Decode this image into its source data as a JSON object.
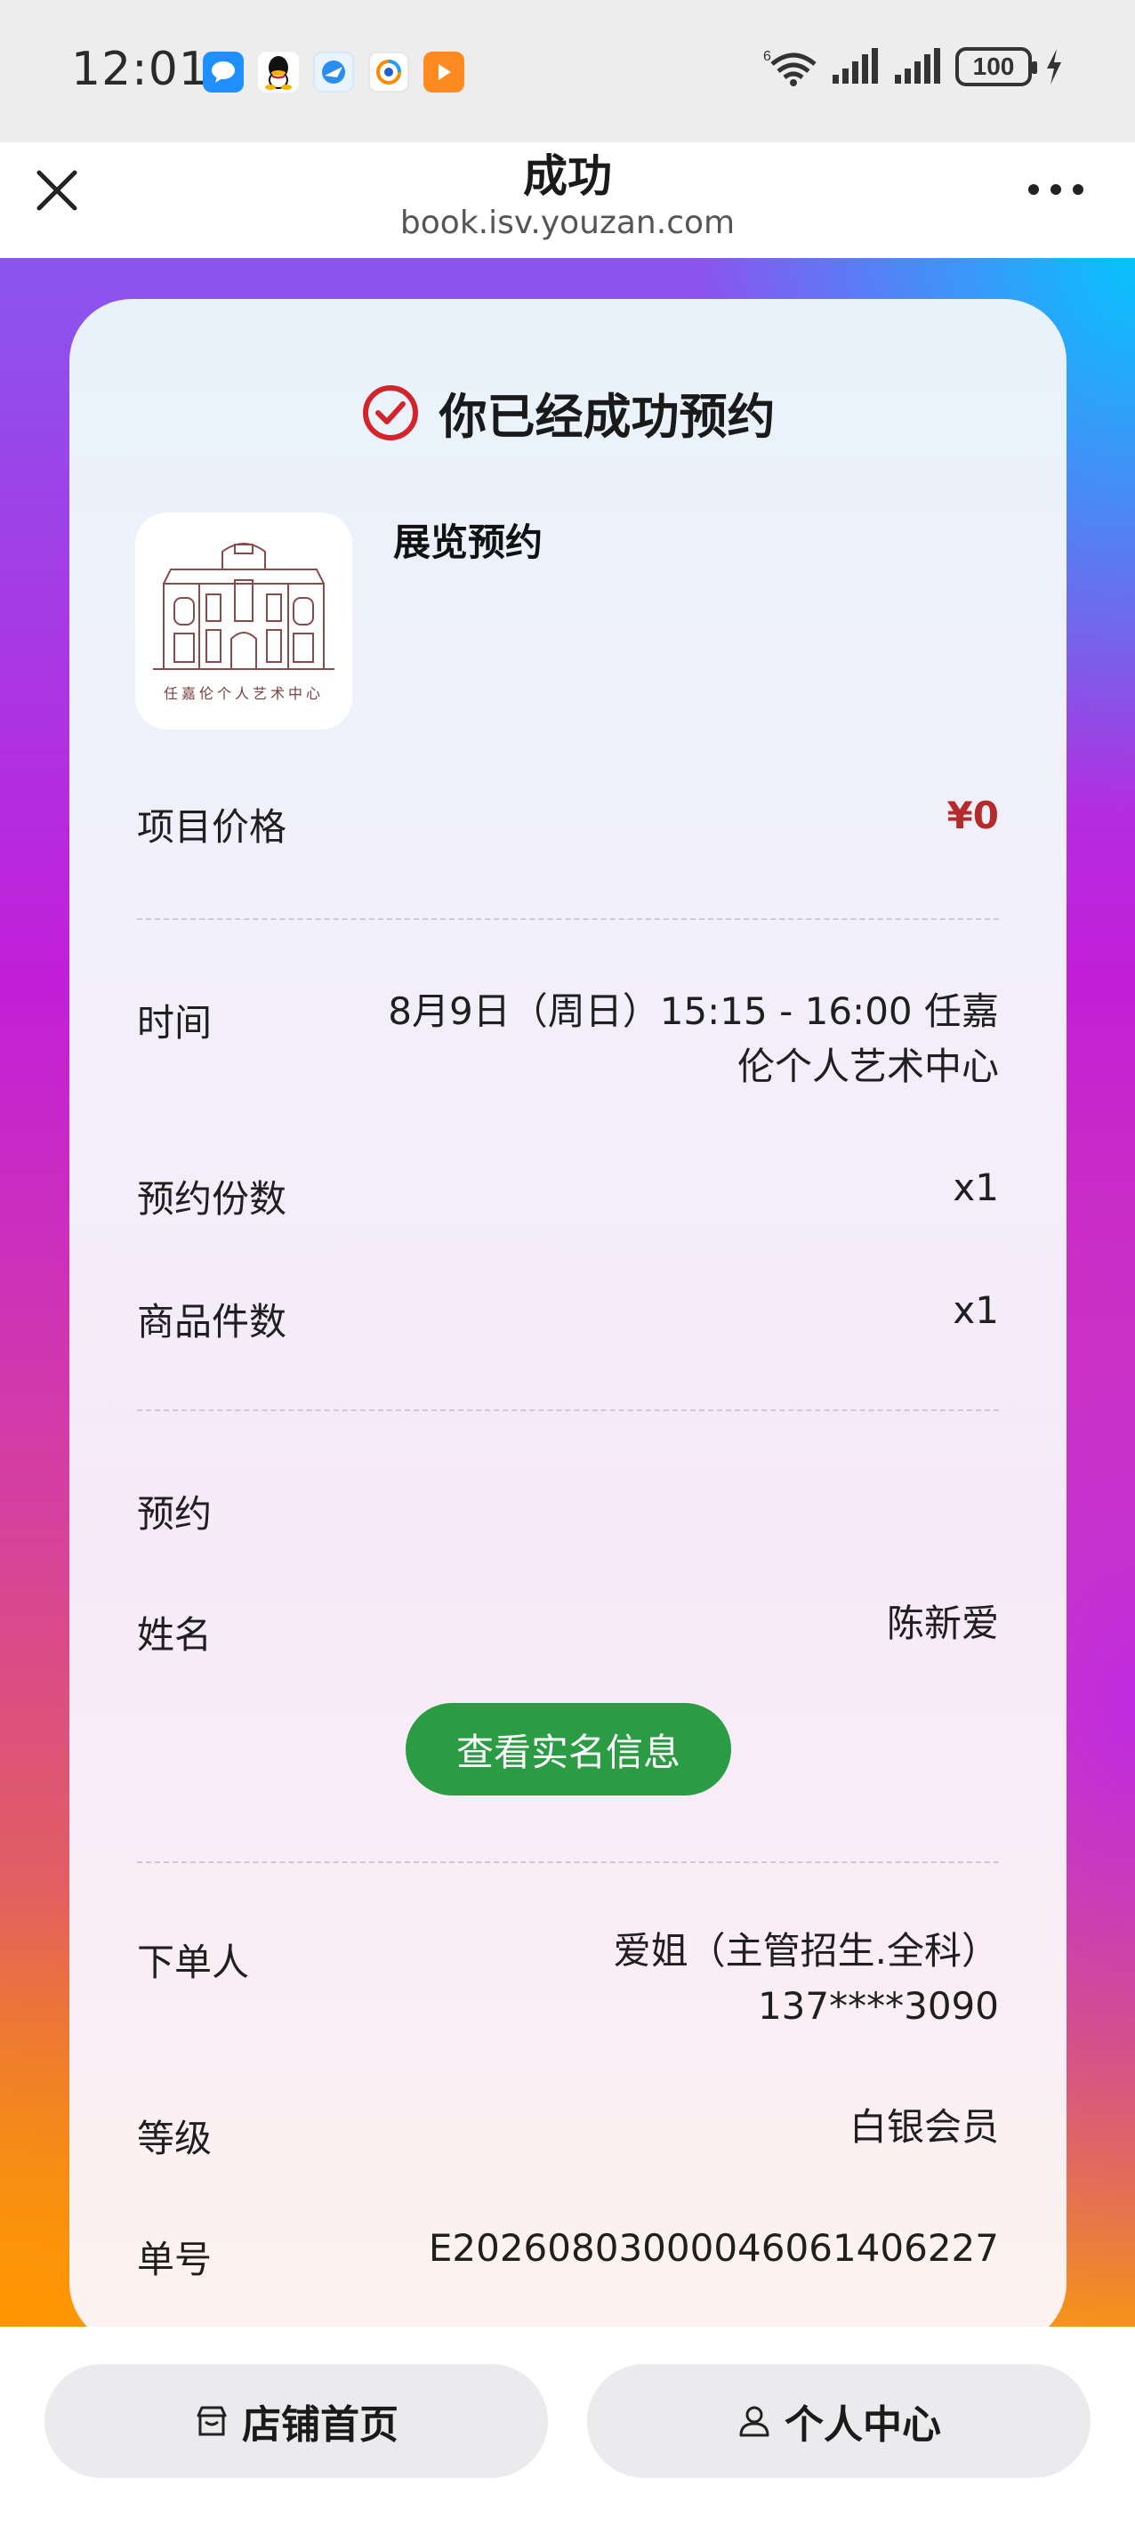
{
  "status_bar": {
    "time": "12:01",
    "network": "6",
    "battery": "100"
  },
  "nav": {
    "title": "成功",
    "url": "book.isv.youzan.com"
  },
  "card": {
    "success_text": "你已经成功预约",
    "product_name": "展览预约",
    "logo_caption": "任嘉伦个人艺术中心",
    "rows": {
      "price_label": "项目价格",
      "price_value": "¥0",
      "time_label": "时间",
      "time_value_line1": "8月9日（周日）15:15 - 16:00 任嘉",
      "time_value_line2": "伦个人艺术中心",
      "quantity_label": "预约份数",
      "quantity_value": "x1",
      "items_label": "商品件数",
      "items_value": "x1",
      "booking_label": "预约",
      "name_label": "姓名",
      "name_value": "陈新爱",
      "realname_button": "查看实名信息",
      "orderer_label": "下单人",
      "orderer_value_line1": "爱姐（主管招生.全科）",
      "orderer_value_line2": "137****3090",
      "level_label": "等级",
      "level_value": "白银会员",
      "order_no_label": "单号",
      "order_no_value": "E20260803000046061406227"
    }
  },
  "bottom": {
    "shop_button": "店铺首页",
    "user_button": "个人中心"
  },
  "colors": {
    "accent_red": "#d4232b",
    "price_red": "#b52b2b",
    "button_green": "#2b9c43"
  }
}
